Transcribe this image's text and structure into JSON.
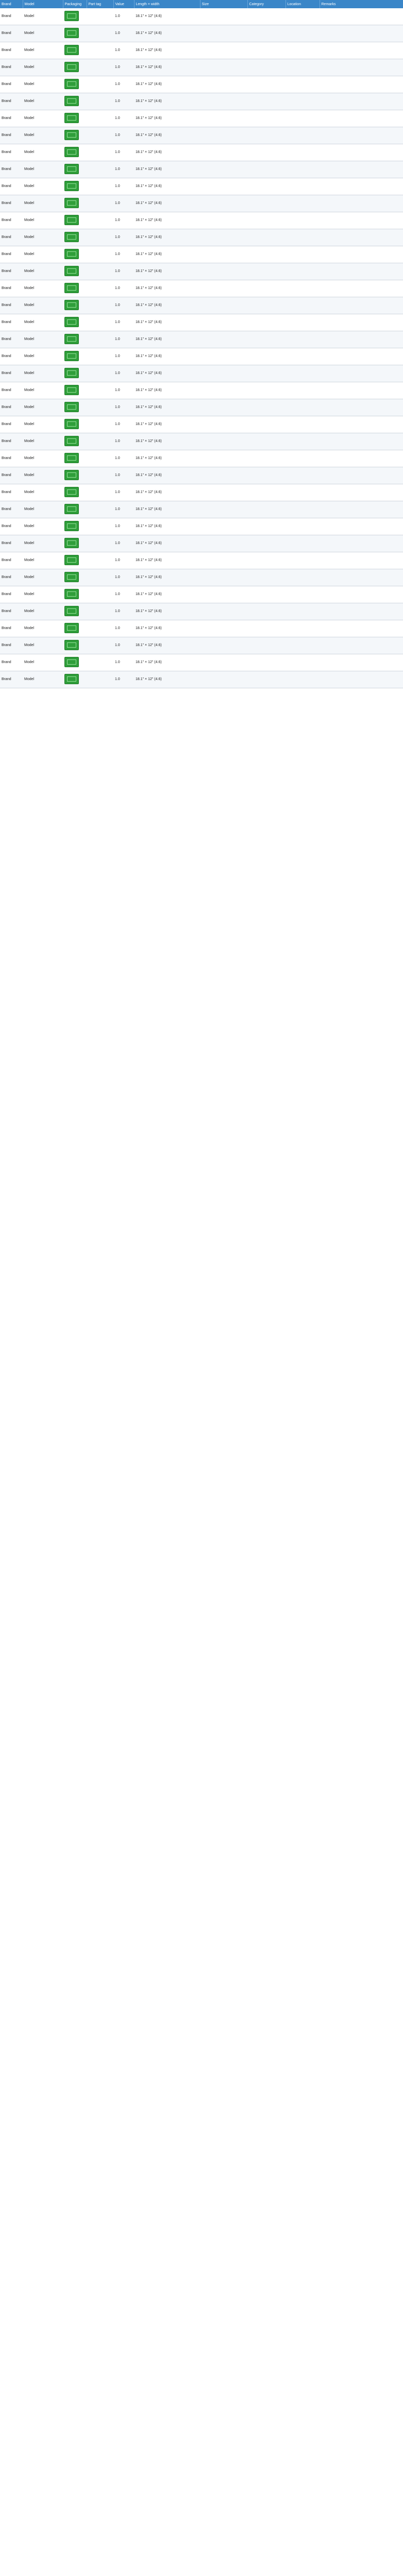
{
  "header": {
    "columns": [
      "Brand",
      "Model",
      "Packaging",
      "Part tag",
      "Value",
      "Length × width",
      "Size",
      "Category",
      "Location",
      "Remarks"
    ]
  },
  "rows": [
    [
      "Brand",
      "Model",
      "",
      "",
      "1.0",
      "18.1\" × 12\" (4.6)",
      "",
      "",
      "",
      ""
    ],
    [
      "Brand",
      "Model",
      "",
      "",
      "1.0",
      "18.1\" × 12\" (4.6)",
      "",
      "",
      "",
      ""
    ],
    [
      "Brand",
      "Model",
      "",
      "",
      "1.0",
      "18.1\" × 12\" (4.6)",
      "",
      "",
      "",
      ""
    ],
    [
      "Brand",
      "Model",
      "",
      "",
      "1.0",
      "18.1\" × 12\" (4.6)",
      "",
      "",
      "",
      ""
    ],
    [
      "Brand",
      "Model",
      "",
      "",
      "1.0",
      "18.1\" × 12\" (4.6)",
      "",
      "",
      "",
      ""
    ],
    [
      "Brand",
      "Model",
      "",
      "",
      "1.0",
      "18.1\" × 12\" (4.6)",
      "",
      "",
      "",
      ""
    ],
    [
      "Brand",
      "Model",
      "",
      "",
      "1.0",
      "18.1\" × 12\" (4.6)",
      "",
      "",
      "",
      ""
    ],
    [
      "Brand",
      "Model",
      "",
      "",
      "1.0",
      "18.1\" × 12\" (4.6)",
      "",
      "",
      "",
      ""
    ],
    [
      "Brand",
      "Model",
      "",
      "",
      "1.0",
      "18.1\" × 12\" (4.6)",
      "",
      "",
      "",
      ""
    ],
    [
      "Brand",
      "Model",
      "",
      "",
      "1.0",
      "18.1\" × 12\" (4.6)",
      "",
      "",
      "",
      ""
    ],
    [
      "Brand",
      "Model",
      "",
      "",
      "1.0",
      "18.1\" × 12\" (4.6)",
      "",
      "",
      "",
      ""
    ],
    [
      "Brand",
      "Model",
      "",
      "",
      "1.0",
      "18.1\" × 12\" (4.6)",
      "",
      "",
      "",
      ""
    ],
    [
      "Brand",
      "Model",
      "",
      "",
      "1.0",
      "18.1\" × 12\" (4.6)",
      "",
      "",
      "",
      ""
    ],
    [
      "Brand",
      "Model",
      "",
      "",
      "1.0",
      "18.1\" × 12\" (4.6)",
      "",
      "",
      "",
      ""
    ],
    [
      "Brand",
      "Model",
      "",
      "",
      "1.0",
      "18.1\" × 12\" (4.6)",
      "",
      "",
      "",
      ""
    ],
    [
      "Brand",
      "Model",
      "",
      "",
      "1.0",
      "18.1\" × 12\" (4.6)",
      "",
      "",
      "",
      ""
    ],
    [
      "Brand",
      "Model",
      "",
      "",
      "1.0",
      "18.1\" × 12\" (4.6)",
      "",
      "",
      "",
      ""
    ],
    [
      "Brand",
      "Model",
      "",
      "",
      "1.0",
      "18.1\" × 12\" (4.6)",
      "",
      "",
      "",
      ""
    ],
    [
      "Brand",
      "Model",
      "",
      "",
      "1.0",
      "18.1\" × 12\" (4.6)",
      "",
      "",
      "",
      ""
    ],
    [
      "Brand",
      "Model",
      "",
      "",
      "1.0",
      "18.1\" × 12\" (4.6)",
      "",
      "",
      "",
      ""
    ],
    [
      "Brand",
      "Model",
      "",
      "",
      "1.0",
      "18.1\" × 12\" (4.6)",
      "",
      "",
      "",
      ""
    ],
    [
      "Brand",
      "Model",
      "",
      "",
      "1.0",
      "18.1\" × 12\" (4.6)",
      "",
      "",
      "",
      ""
    ],
    [
      "Brand",
      "Model",
      "",
      "",
      "1.0",
      "18.1\" × 12\" (4.6)",
      "",
      "",
      "",
      ""
    ],
    [
      "Brand",
      "Model",
      "",
      "",
      "1.0",
      "18.1\" × 12\" (4.6)",
      "",
      "",
      "",
      ""
    ],
    [
      "Brand",
      "Model",
      "",
      "",
      "1.0",
      "18.1\" × 12\" (4.6)",
      "",
      "",
      "",
      ""
    ],
    [
      "Brand",
      "Model",
      "",
      "",
      "1.0",
      "18.1\" × 12\" (4.6)",
      "",
      "",
      "",
      ""
    ],
    [
      "Brand",
      "Model",
      "",
      "",
      "1.0",
      "18.1\" × 12\" (4.6)",
      "",
      "",
      "",
      ""
    ],
    [
      "Brand",
      "Model",
      "",
      "",
      "1.0",
      "18.1\" × 12\" (4.6)",
      "",
      "",
      "",
      ""
    ],
    [
      "Brand",
      "Model",
      "",
      "",
      "1.0",
      "18.1\" × 12\" (4.6)",
      "",
      "",
      "",
      ""
    ],
    [
      "Brand",
      "Model",
      "",
      "",
      "1.0",
      "18.1\" × 12\" (4.6)",
      "",
      "",
      "",
      ""
    ],
    [
      "Brand",
      "Model",
      "",
      "",
      "1.0",
      "18.1\" × 12\" (4.6)",
      "",
      "",
      "",
      ""
    ],
    [
      "Brand",
      "Model",
      "",
      "",
      "1.0",
      "18.1\" × 12\" (4.6)",
      "",
      "",
      "",
      ""
    ],
    [
      "Brand",
      "Model",
      "",
      "",
      "1.0",
      "18.1\" × 12\" (4.6)",
      "",
      "",
      "",
      ""
    ],
    [
      "Brand",
      "Model",
      "",
      "",
      "1.0",
      "18.1\" × 12\" (4.6)",
      "",
      "",
      "",
      ""
    ],
    [
      "Brand",
      "Model",
      "",
      "",
      "1.0",
      "18.1\" × 12\" (4.6)",
      "",
      "",
      "",
      ""
    ],
    [
      "Brand",
      "Model",
      "",
      "",
      "1.0",
      "18.1\" × 12\" (4.6)",
      "",
      "",
      "",
      ""
    ],
    [
      "Brand",
      "Model",
      "",
      "",
      "1.0",
      "18.1\" × 12\" (4.6)",
      "",
      "",
      "",
      ""
    ],
    [
      "Brand",
      "Model",
      "",
      "",
      "1.0",
      "18.1\" × 12\" (4.6)",
      "",
      "",
      "",
      ""
    ],
    [
      "Brand",
      "Model",
      "",
      "",
      "1.0",
      "18.1\" × 12\" (4.6)",
      "",
      "",
      "",
      ""
    ],
    [
      "Brand",
      "Model",
      "",
      "",
      "1.0",
      "18.1\" × 12\" (4.6)",
      "",
      "",
      "",
      ""
    ]
  ]
}
